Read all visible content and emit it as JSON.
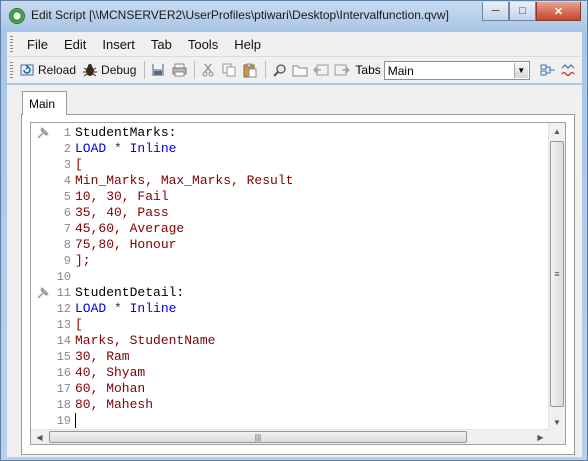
{
  "window": {
    "title": "Edit Script [\\\\MCNSERVER2\\UserProfiles\\ptiwari\\Desktop\\Intervalfunction.qvw]",
    "min_glyph": "─",
    "max_glyph": "□",
    "close_glyph": "✕"
  },
  "menu": {
    "items": [
      "File",
      "Edit",
      "Insert",
      "Tab",
      "Tools",
      "Help"
    ]
  },
  "toolbar": {
    "reload_label": "Reload",
    "debug_label": "Debug",
    "tabs_label": "Tabs",
    "tabs_selected": "Main",
    "icons": [
      "save-icon",
      "print-icon",
      "cut-icon",
      "copy-icon",
      "paste-icon",
      "find-icon",
      "folder-icon",
      "tab-left-icon",
      "tab-right-icon",
      "expression-icon",
      "syntax-check-icon"
    ]
  },
  "tab": {
    "label": "Main"
  },
  "editor": {
    "lines": [
      {
        "n": "1",
        "parts": [
          {
            "t": "StudentMarks:",
            "c": "ident"
          }
        ],
        "pin": true
      },
      {
        "n": "2",
        "parts": [
          {
            "t": "LOAD",
            "c": "kw"
          },
          {
            "t": " * ",
            "c": "op"
          },
          {
            "t": "Inline",
            "c": "kw"
          }
        ]
      },
      {
        "n": "3",
        "parts": [
          {
            "t": "[",
            "c": "str"
          }
        ]
      },
      {
        "n": "4",
        "parts": [
          {
            "t": "Min_Marks, Max_Marks, Result",
            "c": "str"
          }
        ]
      },
      {
        "n": "5",
        "parts": [
          {
            "t": "10, 30, Fail",
            "c": "str"
          }
        ]
      },
      {
        "n": "6",
        "parts": [
          {
            "t": "35, 40, Pass",
            "c": "str"
          }
        ]
      },
      {
        "n": "7",
        "parts": [
          {
            "t": "45,60, Average",
            "c": "str"
          }
        ]
      },
      {
        "n": "8",
        "parts": [
          {
            "t": "75,80, Honour",
            "c": "str"
          }
        ]
      },
      {
        "n": "9",
        "parts": [
          {
            "t": "];",
            "c": "str"
          }
        ]
      },
      {
        "n": "10",
        "parts": []
      },
      {
        "n": "11",
        "parts": [
          {
            "t": "StudentDetail:",
            "c": "ident"
          }
        ],
        "pin": true
      },
      {
        "n": "12",
        "parts": [
          {
            "t": "LOAD",
            "c": "kw"
          },
          {
            "t": " * ",
            "c": "op"
          },
          {
            "t": "Inline",
            "c": "kw"
          }
        ]
      },
      {
        "n": "13",
        "parts": [
          {
            "t": "[",
            "c": "str"
          }
        ]
      },
      {
        "n": "14",
        "parts": [
          {
            "t": "Marks, StudentName",
            "c": "str"
          }
        ]
      },
      {
        "n": "15",
        "parts": [
          {
            "t": "30, Ram",
            "c": "str"
          }
        ]
      },
      {
        "n": "16",
        "parts": [
          {
            "t": "40, Shyam",
            "c": "str"
          }
        ]
      },
      {
        "n": "17",
        "parts": [
          {
            "t": "60, Mohan",
            "c": "str"
          }
        ]
      },
      {
        "n": "18",
        "parts": [
          {
            "t": "80, Mahesh",
            "c": "str"
          }
        ]
      },
      {
        "n": "19",
        "parts": [],
        "cursor": true
      }
    ]
  }
}
